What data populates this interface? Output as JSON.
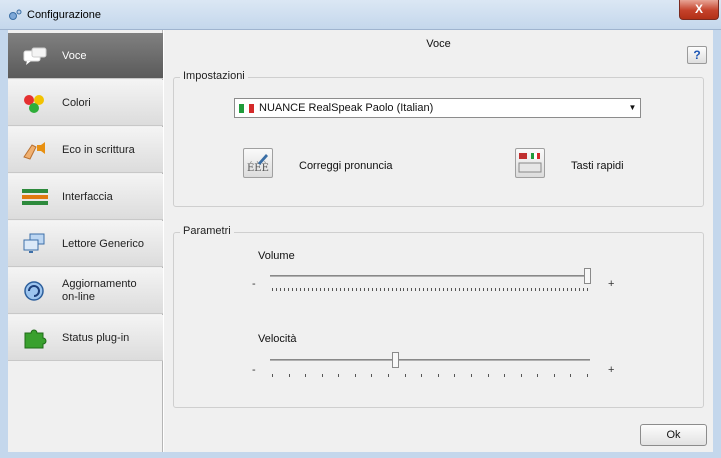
{
  "window": {
    "title": "Configurazione",
    "close_label": "X",
    "title_icon": "gear-icon"
  },
  "sidebar": {
    "items": [
      {
        "label": "Voce",
        "icon": "speech-bubble-icon",
        "active": true
      },
      {
        "label": "Colori",
        "icon": "color-dots-icon",
        "active": false
      },
      {
        "label": "Eco in scrittura",
        "icon": "hand-speaker-icon",
        "active": false
      },
      {
        "label": "Interfaccia",
        "icon": "interface-bars-icon",
        "active": false
      },
      {
        "label": "Lettore Generico",
        "icon": "monitors-icon",
        "active": false
      },
      {
        "label_line1": "Aggiornamento",
        "label_line2": "on-line",
        "icon": "update-globe-icon",
        "active": false
      },
      {
        "label": "Status plug-in",
        "icon": "puzzle-icon",
        "active": false
      }
    ]
  },
  "main": {
    "title": "Voce",
    "help_label": "?",
    "settings": {
      "legend": "Impostazioni",
      "voice_selected": "NUANCE RealSpeak Paolo (Italian)",
      "correct_pronunciation_label": "Correggi pronuncia",
      "hotkeys_label": "Tasti rapidi"
    },
    "parameters": {
      "legend": "Parametri",
      "volume": {
        "label": "Volume",
        "value_fraction": 1.0,
        "min_label": "-",
        "max_label": "+"
      },
      "speed": {
        "label": "Velocità",
        "value_fraction": 0.4,
        "min_label": "-",
        "max_label": "+"
      }
    },
    "ok_label": "Ok"
  },
  "colors": {
    "titlebar": "#c4d7ec",
    "close_button": "#c4412a",
    "active_item": "#6a6a6a",
    "help_icon": "#1e57b5"
  }
}
